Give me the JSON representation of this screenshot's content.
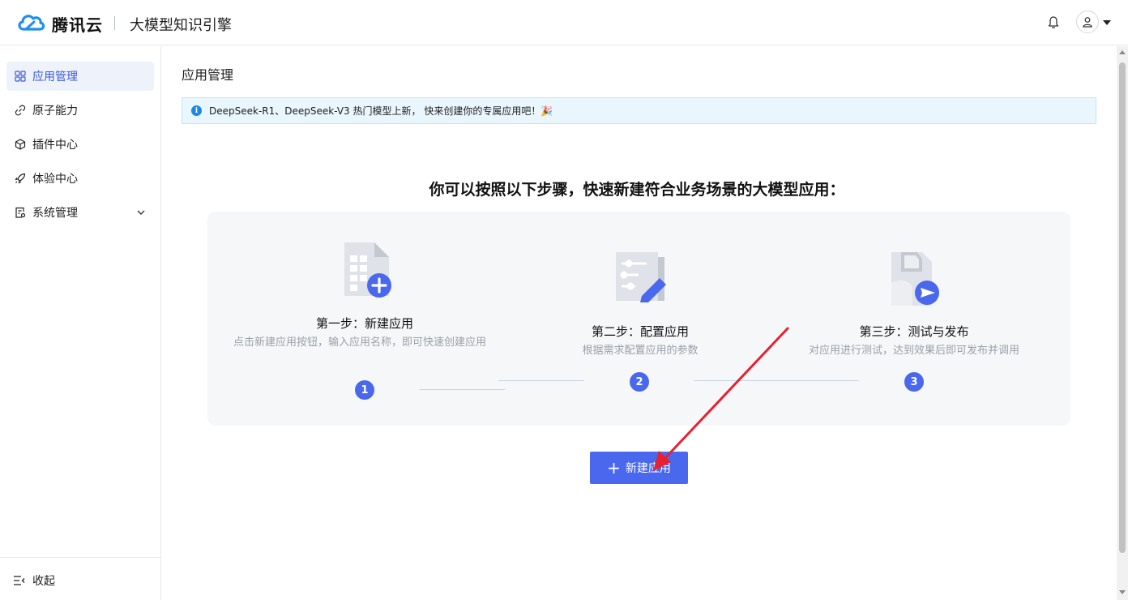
{
  "header": {
    "brand": "腾讯云",
    "product": "大模型知识引擎",
    "icons": {
      "logo": "tencent-cloud-logo",
      "notification": "bell-icon",
      "user": "user-icon",
      "menu": "caret-down-icon"
    }
  },
  "sidebar": {
    "items": [
      {
        "label": "应用管理",
        "icon": "grid-icon",
        "active": true
      },
      {
        "label": "原子能力",
        "icon": "link-icon",
        "active": false
      },
      {
        "label": "插件中心",
        "icon": "cube-icon",
        "active": false
      },
      {
        "label": "体验中心",
        "icon": "rocket-icon",
        "active": false
      },
      {
        "label": "系统管理",
        "icon": "settings-doc-icon",
        "active": false,
        "expandable": true
      }
    ],
    "collapse_label": "收起"
  },
  "main": {
    "page_title": "应用管理",
    "alert_text": "DeepSeek-R1、DeepSeek-V3 热门模型上新， 快来创建你的专属应用吧！🎉",
    "headline": "你可以按照以下步骤，快速新建符合业务场景的大模型应用：",
    "steps": [
      {
        "number": "1",
        "title": "第一步：新建应用",
        "desc": "点击新建应用按钮，输入应用名称，即可快速创建应用"
      },
      {
        "number": "2",
        "title": "第二步：配置应用",
        "desc": "根据需求配置应用的参数"
      },
      {
        "number": "3",
        "title": "第三步：测试与发布",
        "desc": "对应用进行测试，达到效果后即可发布并调用"
      }
    ],
    "create_button": {
      "plus": "+",
      "label": "新建应用"
    }
  },
  "colors": {
    "primary": "#4a68ee",
    "active_nav_bg": "#eef2fb",
    "active_nav_text": "#3b5bdb",
    "alert_bg": "#eaf6fd",
    "info_icon": "#1c87e5",
    "annotation_arrow": "#e8202f"
  }
}
